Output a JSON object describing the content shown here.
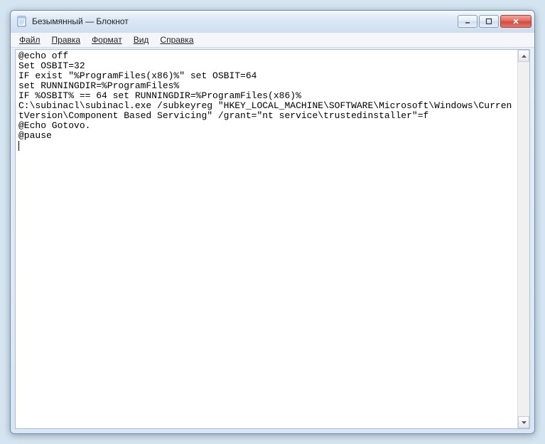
{
  "window": {
    "title": "Безымянный — Блокнот"
  },
  "menu": {
    "file": "Файл",
    "edit": "Правка",
    "format": "Формат",
    "view": "Вид",
    "help": "Справка"
  },
  "editor": {
    "content": "@echo off\nSet OSBIT=32\nIF exist \"%ProgramFiles(x86)%\" set OSBIT=64\nset RUNNINGDIR=%ProgramFiles%\nIF %OSBIT% == 64 set RUNNINGDIR=%ProgramFiles(x86)%\nC:\\subinacl\\subinacl.exe /subkeyreg \"HKEY_LOCAL_MACHINE\\SOFTWARE\\Microsoft\\Windows\\CurrentVersion\\Component Based Servicing\" /grant=\"nt service\\trustedinstaller\"=f\n@Echo Gotovo.\n@pause"
  }
}
